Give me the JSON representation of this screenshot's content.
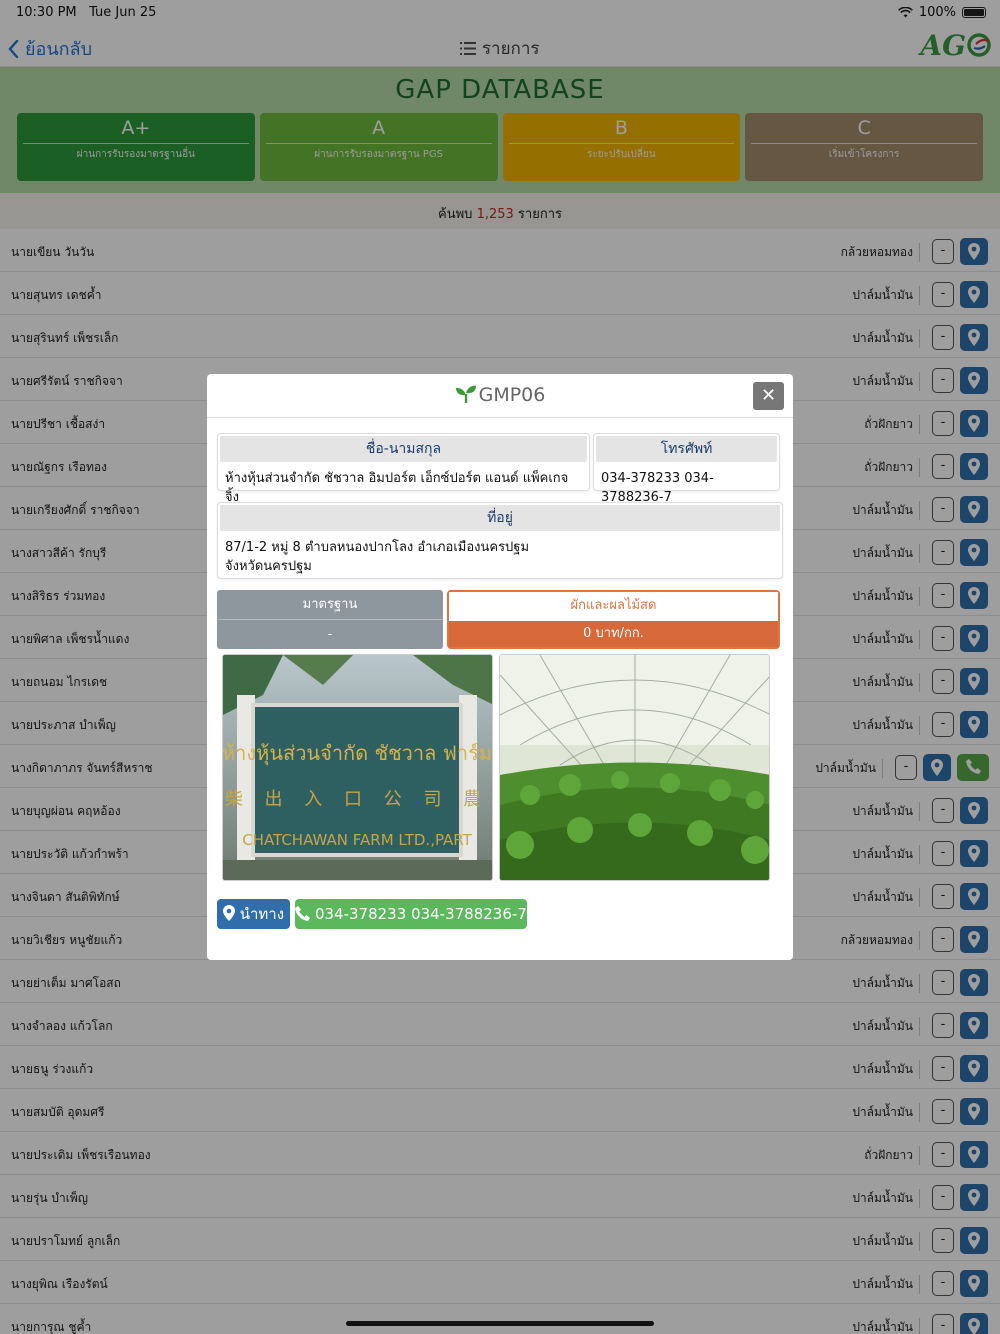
{
  "status_bar": {
    "time": "10:30 PM",
    "date": "Tue Jun 25",
    "battery": "100%"
  },
  "nav": {
    "back_label": "ย้อนกลับ",
    "title": "รายการ",
    "logo": "AG"
  },
  "header": {
    "title": "GAP DATABASE",
    "grades": [
      {
        "label": "A+",
        "desc": "ผ่านการรับรองมาตรฐานอื่น",
        "color": "#2e9a3b"
      },
      {
        "label": "A",
        "desc": "ผ่านการรับรองมาตรฐาน PGS",
        "color": "#6fba3c"
      },
      {
        "label": "B",
        "desc": "ระยะปรับเปลี่ยน",
        "color": "#f0b400"
      },
      {
        "label": "C",
        "desc": "เริ่มเข้าโครงการ",
        "color": "#a58d6c"
      }
    ]
  },
  "result": {
    "prefix": "ค้นพบ",
    "count": "1,253",
    "suffix": "รายการ"
  },
  "list": [
    {
      "name": "นายเขียน วันวัน",
      "crop": "กล้วยหอมทอง"
    },
    {
      "name": "นายสุนทร เดชค้ำ",
      "crop": "ปาล์มน้ำมัน"
    },
    {
      "name": "นายสุรินทร์ เพ็ชรเล็ก",
      "crop": "ปาล์มน้ำมัน"
    },
    {
      "name": "นายศรีรัตน์ ราชกิจจา",
      "crop": "ปาล์มน้ำมัน"
    },
    {
      "name": "นายปรีชา เชื้อสง่า",
      "crop": "ถั่วฝักยาว"
    },
    {
      "name": "นายณัฐกร เรือทอง",
      "crop": "ถั่วฝักยาว"
    },
    {
      "name": "นายเกรียงศักดิ์ ราชกิจจา",
      "crop": "ปาล์มน้ำมัน"
    },
    {
      "name": "นางสาวสีค้า รักบุรี",
      "crop": "ปาล์มน้ำมัน"
    },
    {
      "name": "นางสิริธร ร่วมทอง",
      "crop": "ปาล์มน้ำมัน"
    },
    {
      "name": "นายพิศาล เพ็ชรน้ำแดง",
      "crop": "ปาล์มน้ำมัน"
    },
    {
      "name": "นายถนอม ไกรเดช",
      "crop": "ปาล์มน้ำมัน"
    },
    {
      "name": "นายประภาส บำเพ็ญ",
      "crop": "ปาล์มน้ำมัน"
    },
    {
      "name": "นางกิดาภาภร จันทร์สีหราช",
      "crop": "ปาล์มน้ำมัน",
      "has_call": true
    },
    {
      "name": "นายบุญผ่อน คฤหอ้อง",
      "crop": "ปาล์มน้ำมัน"
    },
    {
      "name": "นายประวัติ แก้วกำพร้า",
      "crop": "ปาล์มน้ำมัน"
    },
    {
      "name": "นางจินดา สันติพิทักษ์",
      "crop": "ปาล์มน้ำมัน"
    },
    {
      "name": "นายวิเชียร หนูชัยแก้ว",
      "crop": "กล้วยหอมทอง"
    },
    {
      "name": "นายย่าเต็ม มาศโอสถ",
      "crop": "ปาล์มน้ำมัน"
    },
    {
      "name": "นางจำลอง แก้วโลก",
      "crop": "ปาล์มน้ำมัน"
    },
    {
      "name": "นายธนู ร่วงแก้ว",
      "crop": "ปาล์มน้ำมัน"
    },
    {
      "name": "นายสมบัติ อุดมศรี",
      "crop": "ปาล์มน้ำมัน"
    },
    {
      "name": "นายประเดิม เพ็ชรเรือนทอง",
      "crop": "ถั่วฝักยาว"
    },
    {
      "name": "นายรุ่น บำเพ็ญ",
      "crop": "ปาล์มน้ำมัน"
    },
    {
      "name": "นายปราโมทย์ ลูกเล็ก",
      "crop": "ปาล์มน้ำมัน"
    },
    {
      "name": "นางยุพิณ เรืองรัตน์",
      "crop": "ปาล์มน้ำมัน"
    },
    {
      "name": "นายการุณ ชูค้ำ",
      "crop": "ปาล์มน้ำมัน"
    }
  ],
  "modal": {
    "title": "GMP06",
    "name_label": "ชื่อ-นามสกุล",
    "name_value": "ห้างหุ้นส่วนจำกัด ชัชวาล อิมปอร์ต เอ็กซ์ปอร์ต แอนด์ แพ็คเกจจิ้ง",
    "phone_label": "โทรศัพท์",
    "phone_value": "034-378233 034-3788236-7",
    "address_label": "ที่อยู่",
    "address_line1": "87/1-2 หมู่ 8 ตำบลหนองปากโลง อำเภอเมืองนครปฐม",
    "address_line2": "จังหวัดนครปฐม",
    "standard_label": "มาตรฐาน",
    "standard_value": "-",
    "product_label": "ผักและผลไม้สด",
    "product_value": "0 บาท/กก.",
    "photo1_sign_line1": "ห้างหุ้นส่วนจำกัด ชัชวาล ฟาร์ม",
    "photo1_sign_line2": "CHATCHAWAN FARM LTD.,PART",
    "nav_button": "นำทาง",
    "call_button": "034-378233 034-3788236-7"
  }
}
